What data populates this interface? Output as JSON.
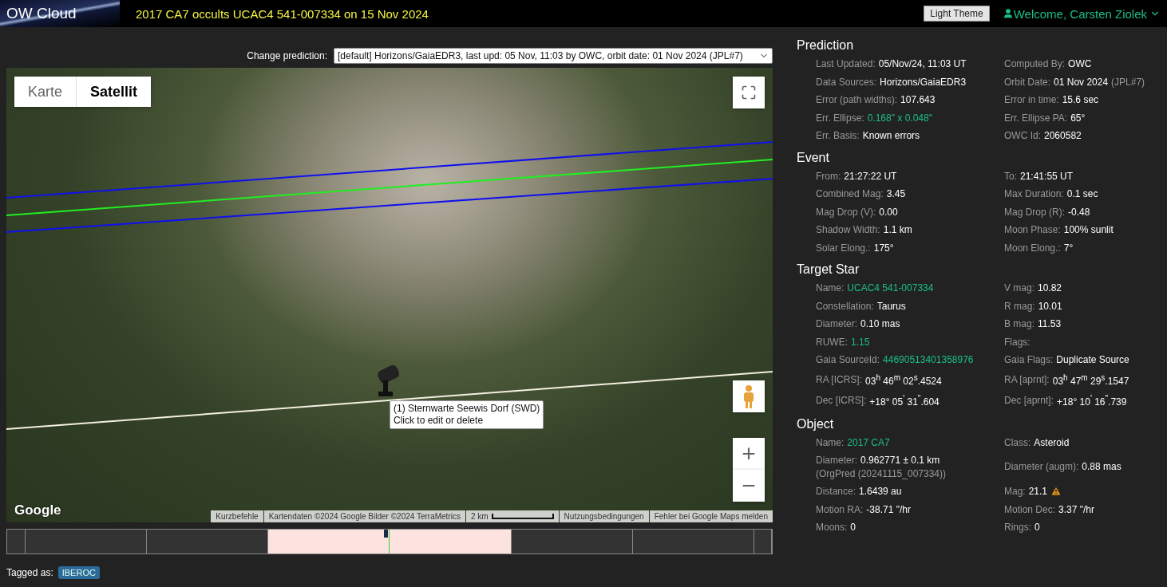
{
  "header": {
    "logo": "OW Cloud",
    "title": "2017 CA7 occults UCAC4 541-007334 on 15 Nov 2024",
    "theme_button": "Light Theme",
    "welcome": "Welcome, Carsten Ziolek"
  },
  "prediction_select": {
    "label": "Change prediction:",
    "value": "[default] Horizons/GaiaEDR3, last upd: 05 Nov, 11:03 by OWC, orbit date: 01 Nov 2024 (JPL#7)"
  },
  "map": {
    "map_types": [
      {
        "label": "Karte",
        "selected": false
      },
      {
        "label": "Satellit",
        "selected": true
      }
    ],
    "marker_tooltip": [
      "(1) Sternwarte Seewis Dorf (SWD)",
      "Click to edit or delete"
    ],
    "zoom_in": "+",
    "zoom_out": "−",
    "logo": "Google",
    "attribution": [
      {
        "kind": "text",
        "text": "Kurzbefehle"
      },
      {
        "kind": "text",
        "text": "Kartendaten ©2024 Google Bilder ©2024 TerraMetrics"
      },
      {
        "kind": "scale",
        "text": "2 km"
      },
      {
        "kind": "text",
        "text": "Nutzungsbedingungen"
      },
      {
        "kind": "text",
        "text": "Fehler bei Google Maps melden"
      }
    ]
  },
  "tags": {
    "label": "Tagged as:",
    "items": [
      "IBEROC"
    ]
  },
  "sections": [
    {
      "title": "Prediction",
      "fields": [
        {
          "label": "Last Updated:",
          "value": "05/Nov/24, 11:03 UT",
          "link": false
        },
        {
          "label": "Computed By:",
          "value": "OWC",
          "link": false
        },
        {
          "label": "Data Sources:",
          "value": "Horizons/GaiaEDR3",
          "link": false
        },
        {
          "label": "Orbit Date:",
          "value": "01 Nov 2024",
          "note": "(JPL#7)",
          "link": false
        },
        {
          "label": "Error (path widths):",
          "value": "107.643",
          "link": false
        },
        {
          "label": "Error in time:",
          "value": "15.6 sec",
          "link": false
        },
        {
          "label": "Err. Ellipse:",
          "value": "0.168\" x 0.048\"",
          "link": true
        },
        {
          "label": "Err. Ellipse PA:",
          "value": "65°",
          "link": false
        },
        {
          "label": "Err. Basis:",
          "value": "Known errors",
          "link": false
        },
        {
          "label": "OWC Id:",
          "value": "2060582",
          "link": false
        }
      ]
    },
    {
      "title": "Event",
      "fields": [
        {
          "label": "From:",
          "value": "21:27:22 UT",
          "link": false
        },
        {
          "label": "To:",
          "value": "21:41:55 UT",
          "link": false
        },
        {
          "label": "Combined Mag:",
          "value": "3.45",
          "link": false
        },
        {
          "label": "Max Duration:",
          "value": "0.1 sec",
          "link": false
        },
        {
          "label": "Mag Drop (V):",
          "value": "0.00",
          "link": false
        },
        {
          "label": "Mag Drop (R):",
          "value": "-0.48",
          "link": false
        },
        {
          "label": "Shadow Width:",
          "value": "1.1 km",
          "link": false
        },
        {
          "label": "Moon Phase:",
          "value": "100% sunlit",
          "link": false
        },
        {
          "label": "Solar Elong.:",
          "value": "175°",
          "link": false
        },
        {
          "label": "Moon Elong.:",
          "value": "7°",
          "link": false
        }
      ]
    },
    {
      "title": "Target Star",
      "fields": [
        {
          "label": "Name:",
          "value": "UCAC4 541-007334",
          "link": true
        },
        {
          "label": "V mag:",
          "value": "10.82",
          "link": false
        },
        {
          "label": "Constellation:",
          "value": "Taurus",
          "link": false
        },
        {
          "label": "R mag:",
          "value": "10.01",
          "link": false
        },
        {
          "label": "Diameter:",
          "value": "0.10 mas",
          "link": false
        },
        {
          "label": "B mag:",
          "value": "11.53",
          "link": false
        },
        {
          "label": "RUWE:",
          "value": "1.15",
          "link": true
        },
        {
          "label": "Flags:"
        },
        {
          "label": "Gaia SourceId:",
          "value": "44690513401358976",
          "link": true
        },
        {
          "label": "Gaia Flags:",
          "value": "Duplicate Source",
          "link": false
        },
        {
          "label": "RA [ICRS]:",
          "value": "03$^{h}$ 46$^{m}$ 02$^{s}$.4524",
          "link": false
        },
        {
          "label": "RA [aprnt]:",
          "value": "03$^{h}$ 47$^{m}$ 29$^{s}$.1547",
          "link": false
        },
        {
          "label": "Dec [ICRS]:",
          "value": "+18° 05$^{'}$ 31$^{\"}$.604",
          "link": false
        },
        {
          "label": "Dec [aprnt]:",
          "value": "+18° 10$^{'}$ 16$^{\"}$.739",
          "link": false
        }
      ]
    },
    {
      "title": "Object",
      "fields": [
        {
          "label": "Name:",
          "value": "2017 CA7",
          "link": true
        },
        {
          "label": "Class:",
          "value": "Asteroid",
          "link": false
        },
        {
          "label": "Diameter:",
          "value": "0.962771 ± 0.1 km",
          "note": "(OrgPred (20241115_007334))",
          "link": false
        },
        {
          "label": "Diameter (augm):",
          "value": "0.88 mas",
          "link": false
        },
        {
          "label": "Distance:",
          "value": "1.6439 au",
          "link": false
        },
        {
          "label": "Mag:",
          "value": "21.1",
          "warning": true,
          "link": false
        },
        {
          "label": "Motion RA:",
          "value": "-38.71 \"/hr",
          "link": false
        },
        {
          "label": "Motion Dec:",
          "value": "3.37 \"/hr",
          "link": false
        },
        {
          "label": "Moons:",
          "value": "0",
          "link": false
        },
        {
          "label": "Rings:",
          "value": "0",
          "link": false
        }
      ]
    }
  ]
}
